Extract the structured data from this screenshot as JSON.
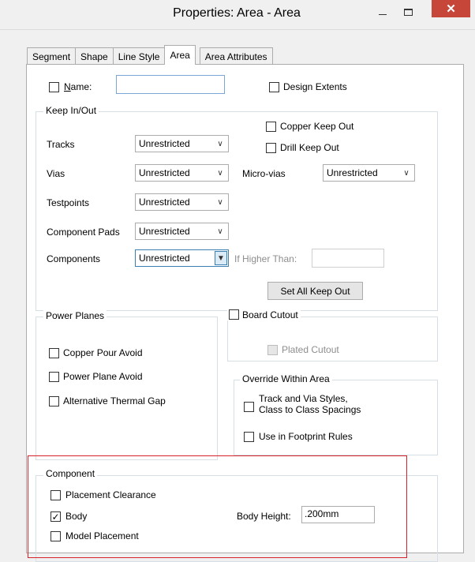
{
  "window": {
    "title": "Properties: Area - Area",
    "minimize_glyph": "–",
    "close_glyph": "✕"
  },
  "tabs": [
    "Segment",
    "Shape",
    "Line Style",
    "Area",
    "Area Attributes"
  ],
  "active_tab": "Area",
  "area": {
    "name_label": "Name:",
    "name_value": "",
    "design_extents_label": "Design Extents"
  },
  "keep_in_out": {
    "title": "Keep In/Out",
    "copper_keep_out": "Copper  Keep Out",
    "drill_keep_out": "Drill  Keep Out",
    "rows": [
      {
        "label": "Tracks",
        "value": "Unrestricted"
      },
      {
        "label": "Vias",
        "value": "Unrestricted"
      },
      {
        "label": "Testpoints",
        "value": "Unrestricted"
      },
      {
        "label": "Component Pads",
        "value": "Unrestricted"
      },
      {
        "label": "Components",
        "value": "Unrestricted"
      }
    ],
    "micro_vias_label": "Micro-vias",
    "micro_vias_value": "Unrestricted",
    "if_higher_than_label": "If Higher Than:",
    "if_higher_than_value": "",
    "set_all_button": "Set All Keep Out"
  },
  "power_planes": {
    "title": "Power Planes",
    "items": [
      "Copper Pour Avoid",
      "Power Plane Avoid",
      "Alternative Thermal Gap"
    ]
  },
  "board_cutout": {
    "title": "Board Cutout",
    "plated_cutout": "Plated Cutout"
  },
  "override": {
    "title": "Override Within Area",
    "styles_line1": "Track and Via Styles,",
    "styles_line2": "Class to Class Spacings",
    "footprint_rules": "Use in Footprint Rules"
  },
  "component": {
    "title": "Component",
    "placement_clearance": "Placement Clearance",
    "body": "Body",
    "body_checked": true,
    "model_placement": "Model Placement",
    "body_height_label": "Body Height:",
    "body_height_value": ".200mm"
  },
  "check_glyph": "✓",
  "colors": {
    "highlight_box": "#d8222a",
    "close_button": "#c7463a",
    "focus_blue": "#3c7fb1"
  }
}
